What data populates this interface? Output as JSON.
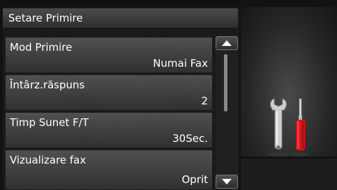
{
  "header": {
    "title": "Setare Primire"
  },
  "menu": {
    "items": [
      {
        "label": "Mod Primire",
        "value": "Numai Fax"
      },
      {
        "label": "Întârz.răspuns",
        "value": "2"
      },
      {
        "label": "Timp Sunet F/T",
        "value": "30Sec."
      },
      {
        "label": "Vizualizare fax",
        "value": "Oprit"
      }
    ]
  },
  "icons": {
    "scroll_up": "chevron-up-icon",
    "scroll_down": "chevron-down-icon",
    "tools": "wrench-screwdriver-icon"
  },
  "colors": {
    "screwdriver_handle": "#d0161c",
    "background": "#121212"
  }
}
